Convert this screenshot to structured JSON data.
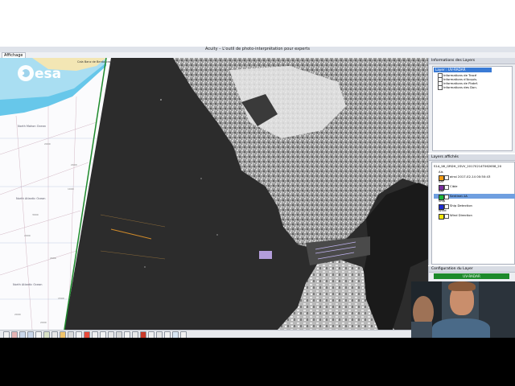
{
  "window": {
    "title": "Acuity – L'outil de photo-interprétation pour experts"
  },
  "menu": {
    "affichage": "Affichage"
  },
  "brand": {
    "logo_text": "esa"
  },
  "chart": {
    "town_label": "Cala Banz de Benta orada",
    "labels": [
      "North Mahon Ocean",
      "North Atlantic Ocean",
      "North Atlantic Ocean"
    ],
    "depth_marks": [
      "2000",
      "2000",
      "3000",
      "1000",
      "2000",
      "2000",
      "1500",
      "2000",
      "2000"
    ]
  },
  "info_panel": {
    "title": "Informations des Layers",
    "selected": "Layer : UV-RADAR",
    "items": [
      "Informations de Tracé",
      "Informations d'Acquis.",
      "Informations de Platef.",
      "Informations des Don."
    ]
  },
  "layers_panel": {
    "title": "Layers affichés",
    "root": "S1A_IW_GRDH_1SVV_20170214T062658_20",
    "rows": [
      {
        "group": "Ais",
        "label": ""
      },
      {
        "group": "",
        "label": "ainsi 2017-02-14 00:50:43",
        "color": "#f39c12"
      },
      {
        "group": "Sar",
        "label": ""
      },
      {
        "group": "",
        "label": "Cible",
        "color": "#7a2ca0"
      },
      {
        "group": "Sar",
        "label": ""
      },
      {
        "group": "",
        "label": "Sentinel-1A",
        "color": "#19b83a",
        "selected": true
      },
      {
        "group": "Ship",
        "label": ""
      },
      {
        "group": "",
        "label": "Ship Detection",
        "color": "#1d2bd6"
      },
      {
        "group": "Wind",
        "label": ""
      },
      {
        "group": "",
        "label": "Wind Direction",
        "color": "#f2e60a"
      }
    ]
  },
  "config_panel": {
    "title": "Configuration du Layer",
    "button": "UV-RADAR"
  },
  "colors": {
    "selection": "#3a7bd5",
    "button": "#1d8a2b"
  }
}
